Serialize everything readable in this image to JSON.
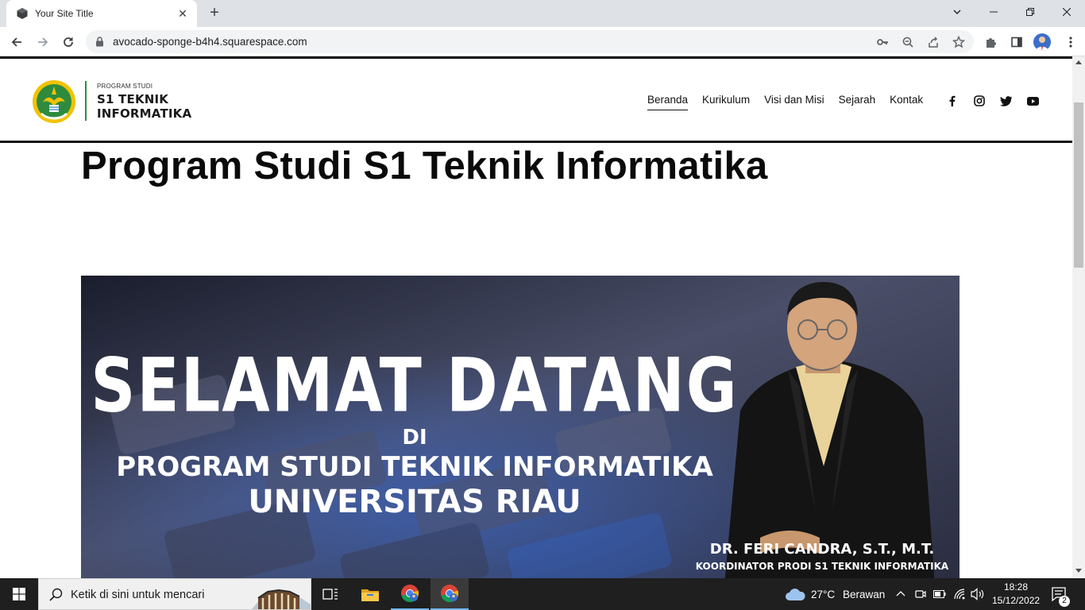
{
  "browser": {
    "tab_title": "Your Site Title",
    "url": "avocado-sponge-b4h4.squarespace.com"
  },
  "site": {
    "logo_small": "PROGRAM STUDI",
    "logo_line1": "S1 TEKNIK",
    "logo_line2": "INFORMATIKA",
    "nav": [
      {
        "label": "Beranda",
        "active": true
      },
      {
        "label": "Kurikulum",
        "active": false
      },
      {
        "label": "Visi dan Misi",
        "active": false
      },
      {
        "label": "Sejarah",
        "active": false
      },
      {
        "label": "Kontak",
        "active": false
      }
    ],
    "social_icons": [
      "facebook-icon",
      "instagram-icon",
      "twitter-icon",
      "youtube-icon"
    ],
    "page_title": "Program Studi S1 Teknik Informatika"
  },
  "banner": {
    "heading": "SELAMAT DATANG",
    "di": "DI",
    "line1": "PROGRAM STUDI TEKNIK INFORMATIKA",
    "line2": "UNIVERSITAS RIAU",
    "person_name": "DR. FERI CANDRA, S.T., M.T.",
    "person_title": "KOORDINATOR PRODI S1 TEKNIK INFORMATIKA"
  },
  "taskbar": {
    "search_placeholder": "Ketik di sini untuk mencari",
    "weather_temp": "27°C",
    "weather_desc": "Berawan",
    "time": "18:28",
    "date": "15/12/2022",
    "notification_count": "2"
  },
  "colors": {
    "chrome_bg": "#dee1e6",
    "logo_green": "#2e8b3e",
    "logo_yellow": "#f2c200",
    "taskbar_bg": "#1f1f1f"
  }
}
